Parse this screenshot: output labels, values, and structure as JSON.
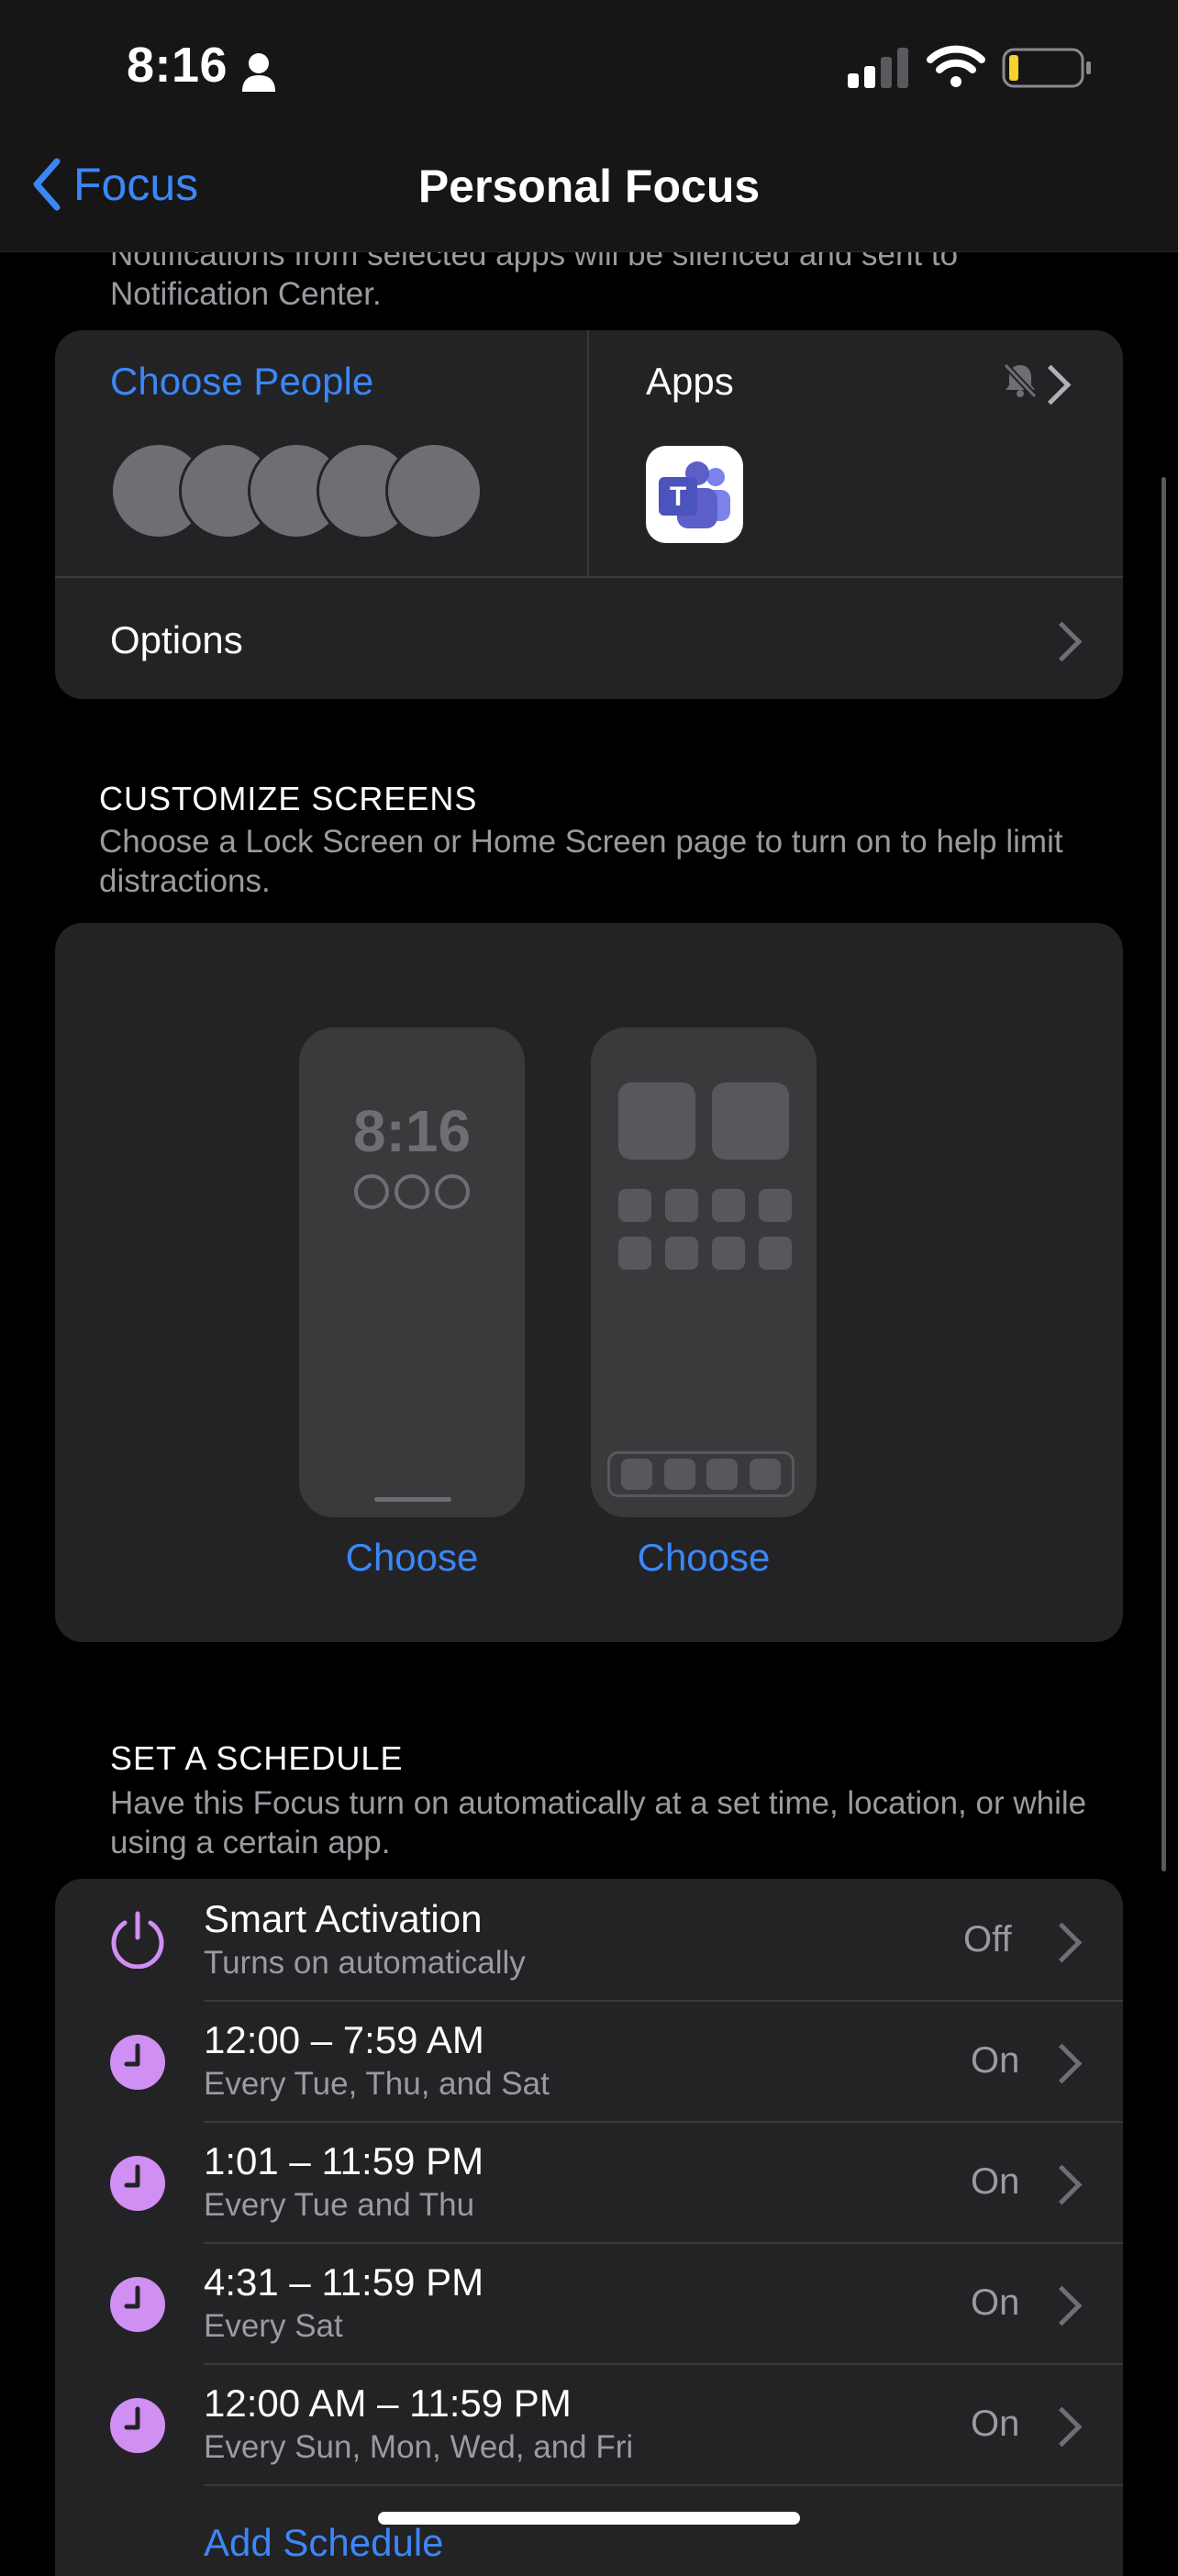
{
  "status_bar": {
    "time": "8:16"
  },
  "nav": {
    "back_label": "Focus",
    "title": "Personal Focus"
  },
  "intro_text": "Notifications from selected apps will be silenced and sent to Notification Center.",
  "people_apps": {
    "choose_people": "Choose People",
    "apps_label": "Apps",
    "options_label": "Options"
  },
  "customize": {
    "header": "CUSTOMIZE SCREENS",
    "subtitle": "Choose a Lock Screen or Home Screen page to turn on to help limit distractions.",
    "lock_preview_time": "8:16",
    "lock_choose": "Choose",
    "home_choose": "Choose"
  },
  "schedule": {
    "header": "SET A SCHEDULE",
    "subtitle": "Have this Focus turn on automatically at a set time, location, or while using a certain app.",
    "rows": [
      {
        "title": "Smart Activation",
        "subtitle": "Turns on automatically",
        "state": "Off",
        "icon": "power-icon"
      },
      {
        "title": "12:00 – 7:59 AM",
        "subtitle": "Every Tue, Thu, and Sat",
        "state": "On",
        "icon": "clock-icon"
      },
      {
        "title": "1:01 – 11:59 PM",
        "subtitle": "Every Tue and Thu",
        "state": "On",
        "icon": "clock-icon"
      },
      {
        "title": "4:31 – 11:59 PM",
        "subtitle": "Every Sat",
        "state": "On",
        "icon": "clock-icon"
      },
      {
        "title": "12:00 AM – 11:59 PM",
        "subtitle": "Every Sun, Mon, Wed, and Fri",
        "state": "On",
        "icon": "clock-icon"
      }
    ],
    "add_label": "Add Schedule"
  },
  "colors": {
    "accent": "#3b87f7",
    "schedule_icon": "#d08ff2",
    "card": "#232325"
  }
}
